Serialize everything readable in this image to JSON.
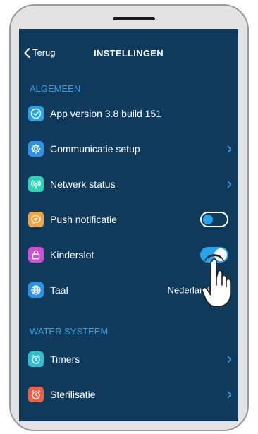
{
  "header": {
    "back_label": "Terug",
    "title": "INSTELLINGEN"
  },
  "sections": {
    "general_label": "ALGEMEEN",
    "water_label": "WATER SYSTEEM"
  },
  "settings": {
    "app_version": {
      "label": "App version 3.8 build 151",
      "icon": "check-circle-icon"
    },
    "communication": {
      "label": "Communicatie setup",
      "icon": "gear-icon"
    },
    "network": {
      "label": "Netwerk status",
      "icon": "antenna-icon"
    },
    "push": {
      "label": "Push notificatie",
      "icon": "chat-bubble-icon",
      "enabled": false
    },
    "child_lock": {
      "label": "Kinderslot",
      "icon": "lock-icon",
      "enabled": true
    },
    "language": {
      "label": "Taal",
      "icon": "globe-icon",
      "value": "Nederlands"
    },
    "timers": {
      "label": "Timers",
      "icon": "alarm-clock-icon"
    },
    "sterilization": {
      "label": "Sterilisatie",
      "icon": "alarm-clock-icon"
    }
  },
  "colors": {
    "background": "#0f3a5b",
    "accent": "#2aa4e8",
    "app_version_icon": "#29a3e8",
    "communication_icon": "#2b92e8",
    "network_icon": "#2ed3b4",
    "push_icon": "#f2a444",
    "child_lock_icon": "#d24fd4",
    "language_icon": "#2b92e8",
    "timers_icon": "#2ebfd0",
    "sterilization_icon": "#ee6047"
  }
}
